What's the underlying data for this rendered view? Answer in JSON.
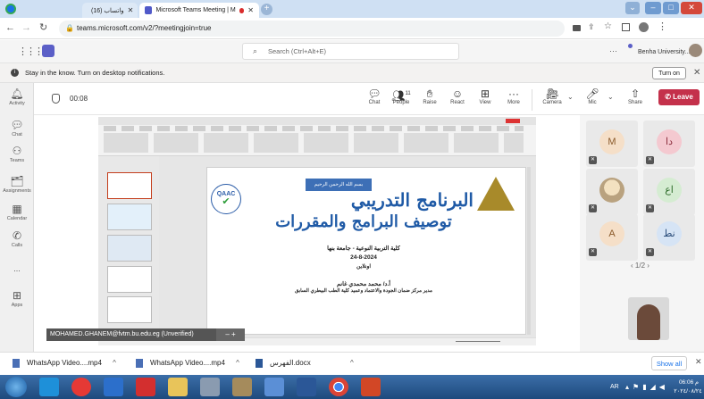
{
  "browser": {
    "tabs": [
      {
        "label": "(16) واتساب",
        "active": false
      },
      {
        "label": "Microsoft Teams Meeting | M",
        "active": true
      }
    ],
    "url": "teams.microsoft.com/v2/?meetingjoin=true"
  },
  "teams": {
    "search_placeholder": "Search (Ctrl+Alt+E)",
    "account": "Benha University...",
    "notification": "Stay in the know. Turn on desktop notifications.",
    "turn_on_label": "Turn on",
    "rail": [
      "Activity",
      "Chat",
      "Teams",
      "Assignments",
      "Calendar",
      "Calls",
      "...",
      "Apps"
    ],
    "meeting": {
      "timer": "00:08",
      "controls": [
        {
          "label": "Chat",
          "icon": "chat-icon"
        },
        {
          "label": "People",
          "icon": "people-icon",
          "count": "11"
        },
        {
          "label": "Raise",
          "icon": "raise-hand-icon"
        },
        {
          "label": "React",
          "icon": "react-icon"
        },
        {
          "label": "View",
          "icon": "view-icon"
        },
        {
          "label": "More",
          "icon": "more-icon"
        },
        {
          "label": "Camera",
          "icon": "camera-icon"
        },
        {
          "label": "Mic",
          "icon": "mic-icon"
        },
        {
          "label": "Share",
          "icon": "share-icon"
        }
      ],
      "leave_label": "Leave"
    },
    "presenter": "MOHAMED.GHANEM@fvtm.bu.edu.eg (Unverified)",
    "participants": [
      {
        "initial": "M",
        "color": "#f5dfc8",
        "text": "#8a5a2a"
      },
      {
        "initial": "دا",
        "color": "#f4c9d0",
        "text": "#8a2a3a"
      },
      {
        "initial": "",
        "photo": true
      },
      {
        "initial": "اع",
        "color": "#d5ecd2",
        "text": "#2c6a28"
      },
      {
        "initial": "A",
        "color": "#f5dfc8",
        "text": "#8a5a2a"
      },
      {
        "initial": "نط",
        "color": "#d6e4f5",
        "text": "#2a4c7a"
      }
    ],
    "page_indicator": "1/2"
  },
  "slide": {
    "bismillah": "بسم الله الرحمن الرحيم",
    "title_line1": "البرنامج التدريبي",
    "title_line2": "توصيف البرامج والمقررات",
    "faculty": "كلية التربية النوعية - جامعة بنها",
    "date": "24-8-2024",
    "mode": "اونلاين",
    "presenter": "أ.د/ محمد محمدي غانم",
    "role": "مدير مركز ضمان الجودة والاعتماد وعميد كلية الطب البيطري السابق",
    "logo_text": "QAAC"
  },
  "downloads": [
    {
      "name": "WhatsApp Video....mp4"
    },
    {
      "name": "WhatsApp Video....mp4"
    },
    {
      "name": "الفهرس.docx"
    }
  ],
  "show_all_label": "Show all",
  "taskbar": {
    "lang": "AR",
    "time": "06:06 م",
    "date": "٢٠٢٤/٠٨/٢٤"
  }
}
